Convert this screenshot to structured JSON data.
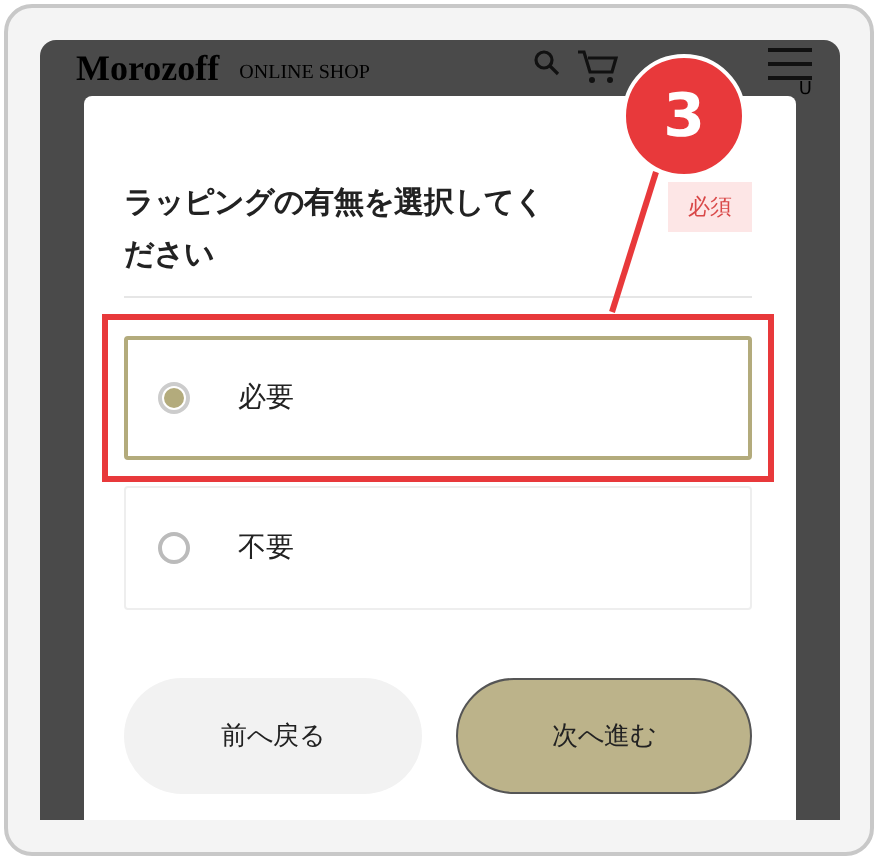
{
  "header": {
    "logo": "Morozoff",
    "subtitle": "ONLINE SHOP",
    "menu_label": "U"
  },
  "dialog": {
    "title": "ラッピングの有無を選択してください",
    "badge": "必須",
    "options": [
      {
        "label": "必要",
        "selected": true,
        "highlighted": true
      },
      {
        "label": "不要",
        "selected": false,
        "highlighted": false
      }
    ],
    "buttons": [
      {
        "label": "前へ戻る",
        "kind": "secondary"
      },
      {
        "label": "次へ進む",
        "kind": "primary"
      }
    ]
  },
  "annotation": {
    "label": "3"
  }
}
